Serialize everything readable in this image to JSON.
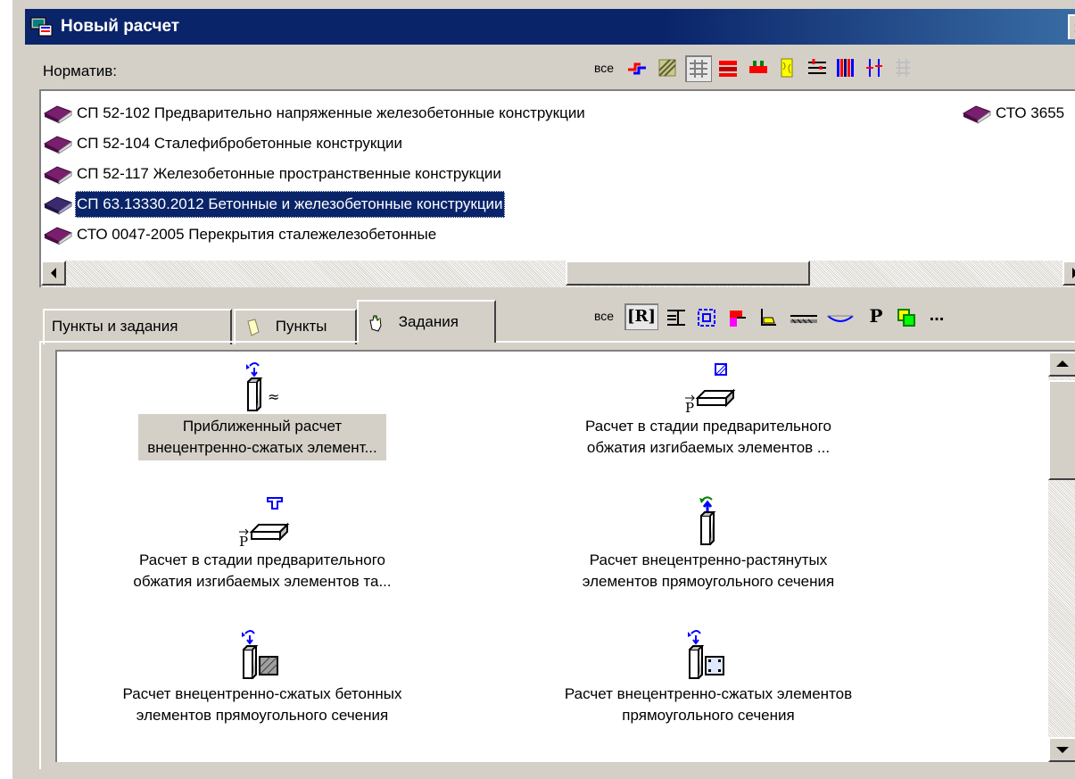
{
  "window": {
    "title": "Новый расчет",
    "close_label": "×"
  },
  "normativ": {
    "label": "Норматив:",
    "filter_all": "все",
    "items": [
      {
        "text": "СП 52-102 Предварительно напряженные железобетонные конструкции"
      },
      {
        "text": "СП 52-104 Сталефибробетонные конструкции"
      },
      {
        "text": "СП 52-117 Железобетонные пространственные конструкции"
      },
      {
        "text": "СП 63.13330.2012 Бетонные и железобетонные конструкции",
        "selected": true
      },
      {
        "text": "СТО 0047-2005 Перекрытия сталежелезобетонные"
      }
    ],
    "second_column_item": "СТО 3655"
  },
  "tabs": {
    "items": [
      {
        "label": "Пункты и задания"
      },
      {
        "label": "Пункты"
      },
      {
        "label": "Задания",
        "active": true
      }
    ],
    "filter_all": "все",
    "toolbar_r": "[R]",
    "toolbar_p": "P",
    "toolbar_more": "..."
  },
  "tasks": [
    {
      "line1": "Приближенный расчет",
      "line2": "внецентренно-сжатых элемент...",
      "selected": true
    },
    {
      "line1": "Расчет в стадии предварительного",
      "line2": "обжатия изгибаемых элементов ..."
    },
    {
      "line1": "Расчет в стадии предварительного",
      "line2": "обжатия изгибаемых элементов та..."
    },
    {
      "line1": "Расчет внецентренно-растянутых",
      "line2": "элементов прямоугольного сечения"
    },
    {
      "line1": "Расчет внецентренно-сжатых бетонных",
      "line2": "элементов прямоугольного сечения"
    },
    {
      "line1": "Расчет внецентренно-сжатых элементов",
      "line2": "прямоугольного сечения"
    }
  ],
  "icons": {
    "book": "book-icon",
    "colors": {
      "selection": "#0a246a",
      "titlebar": "#0a246a",
      "book": "#7a1e6e",
      "accent_blue": "#0000ff",
      "accent_red": "#ff0000"
    }
  }
}
